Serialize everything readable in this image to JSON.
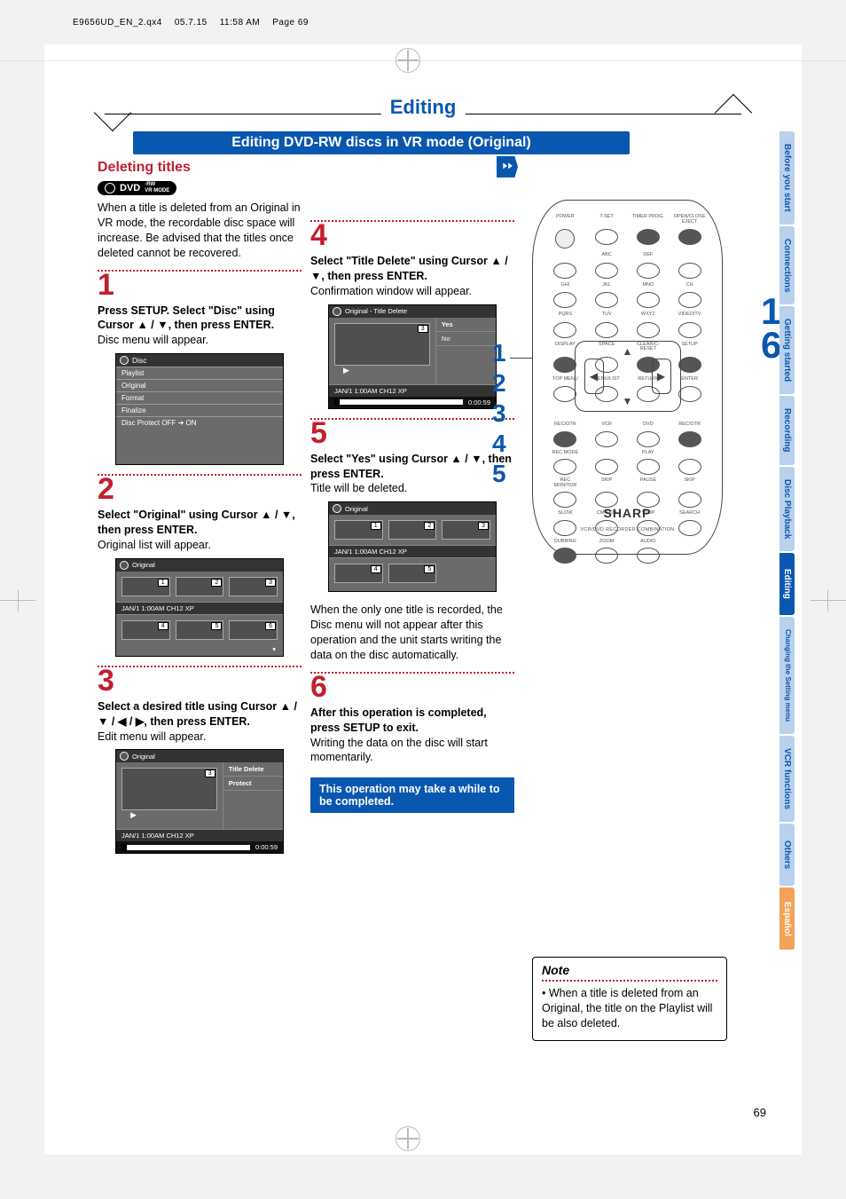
{
  "running_head": {
    "file": "E9656UD_EN_2.qx4",
    "date": "05.7.15",
    "time": "11:58 AM",
    "page": "Page 69"
  },
  "page_title": "Editing",
  "section_bar": "Editing DVD-RW discs in VR mode (Original)",
  "subheading": "Deleting titles",
  "dvd_badge": {
    "main": "DVD",
    "sub1": "-RW",
    "sub2": "VR MODE"
  },
  "intro": "When a title is deleted from an Original in VR mode, the recordable disc space will increase. Be advised that the titles once deleted cannot be recovered.",
  "steps": {
    "s1": {
      "num": "1",
      "head": "Press SETUP. Select \"Disc\" using Cursor ▲ / ▼, then press ENTER.",
      "tail": "Disc menu will appear."
    },
    "s2": {
      "num": "2",
      "head": "Select \"Original\" using Cursor ▲ / ▼, then press ENTER.",
      "tail": "Original list will appear."
    },
    "s3": {
      "num": "3",
      "head": "Select a desired title using Cursor ▲ / ▼ / ◀ / ▶, then press ENTER.",
      "tail": "Edit menu will appear."
    },
    "s4": {
      "num": "4",
      "head": "Select \"Title Delete\" using Cursor ▲ / ▼, then press ENTER.",
      "tail": "Confirmation window will appear."
    },
    "s5": {
      "num": "5",
      "head": "Select \"Yes\" using Cursor ▲ / ▼, then press ENTER.",
      "tail": "Title will be deleted."
    },
    "s6": {
      "num": "6",
      "head": "After this operation is completed, press SETUP to exit.",
      "tail": "Writing the data on the disc will start momentarily."
    }
  },
  "post5": "When the only one title is recorded, the Disc menu will not appear after this operation and the unit starts writing the data on the disc automatically.",
  "callout": "This operation may take a while to be completed.",
  "disc_menu": {
    "title": "Disc",
    "items": [
      "Playlist",
      "Original",
      "Format",
      "Finalize",
      "Disc Protect OFF ➔ ON"
    ]
  },
  "original_panel": {
    "title": "Original",
    "meta": "JAN/1 1:00AM CH12 XP",
    "tags_top": [
      "1",
      "2",
      "3"
    ],
    "tags_bot": [
      "4",
      "5",
      "6"
    ]
  },
  "edit_panel": {
    "title": "Original",
    "tag": "3",
    "opts": [
      "Title Delete",
      "Protect"
    ],
    "meta": "JAN/1 1:00AM CH12 XP",
    "time": "0:00:59"
  },
  "confirm_panel": {
    "title": "Original - Title Delete",
    "tag": "3",
    "yes": "Yes",
    "no": "No",
    "meta": "JAN/1 1:00AM CH12 XP",
    "time": "0:00:59"
  },
  "result_panel": {
    "title": "Original",
    "tags_top": [
      "1",
      "2",
      "3"
    ],
    "meta": "JAN/1 1:00AM CH12 XP",
    "tags_bot": [
      "4",
      "5"
    ]
  },
  "note": {
    "head": "Note",
    "body": "• When a title is deleted from an Original, the title on the Playlist will be also deleted."
  },
  "remote": {
    "row1": [
      "POWER",
      "T-SET",
      "TIMER PROG.",
      "OPEN/CLOSE EJECT"
    ],
    "row2": [
      "",
      "ABC",
      "DEF",
      ""
    ],
    "row3": [
      "GHI",
      "JKL",
      "MNO",
      "CH"
    ],
    "row4": [
      "PQRS",
      "TUV",
      "WXYZ",
      "VIDEO/TV"
    ],
    "row5": [
      "DISPLAY",
      "SPACE",
      "CLEAR/C-RESET",
      "SETUP"
    ],
    "row6": [
      "TOP MENU",
      "MENU/LIST",
      "RETURN",
      "ENTER"
    ],
    "dpad_arrows": [
      "▲",
      "▼",
      "◀",
      "▶"
    ],
    "lrow1": [
      "REC/OTR",
      "VCR",
      "DVD",
      "REC/OTR"
    ],
    "lrow2": [
      "REC MODE",
      "",
      "PLAY",
      ""
    ],
    "lrow3": [
      "REC MONITOR",
      "SKIP",
      "PAUSE",
      "SKIP"
    ],
    "lrow4": [
      "SLOW",
      "CM SKIP",
      "STOP",
      "SEARCH"
    ],
    "lrow5": [
      "DUBBING",
      "ZOOM",
      "AUDIO",
      ""
    ],
    "logo": "SHARP",
    "sublogo": "VCR/DVD RECORDER COMBINATION"
  },
  "left_nums": [
    "1",
    "2",
    "3",
    "4",
    "5"
  ],
  "right_nums": [
    "1",
    "6"
  ],
  "side_tabs": [
    {
      "t": "Before you start",
      "c": "b9d1ed"
    },
    {
      "t": "Connections",
      "c": "b9d1ed"
    },
    {
      "t": "Getting started",
      "c": "b9d1ed"
    },
    {
      "t": "Recording",
      "c": "b9d1ed"
    },
    {
      "t": "Disc Playback",
      "c": "b9d1ed"
    },
    {
      "t": "Editing",
      "c": "current"
    },
    {
      "t": "Changing the Setting menu",
      "c": "b9d1ed"
    },
    {
      "t": "VCR functions",
      "c": "b9d1ed"
    },
    {
      "t": "Others",
      "c": "b9d1ed"
    },
    {
      "t": "Español",
      "c": "orange"
    }
  ],
  "page_number": "69"
}
